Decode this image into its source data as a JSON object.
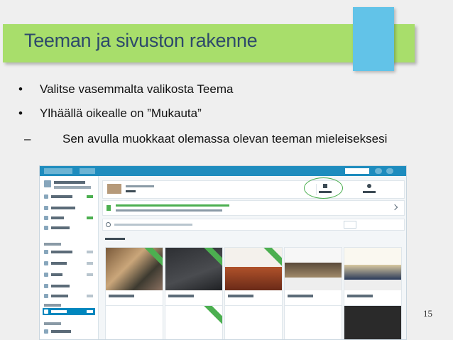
{
  "slide": {
    "title": "Teeman ja sivuston rakenne",
    "bullets": [
      {
        "marker": "•",
        "text": "Valitse vasemmalta valikosta Teema"
      },
      {
        "marker": "•",
        "text": "Ylhäällä oikealle on ”Mukauta”"
      }
    ],
    "sub_bullet": {
      "marker": "–",
      "text": "Sen avulla muokkaat olemassa olevan teeman mieleiseksesi"
    },
    "page_number": "15"
  },
  "colors": {
    "title_bar": "#a8de6b",
    "title_text": "#2e4a6b",
    "corner_tab": "#62c3e8",
    "wp_admin_bar": "#1e8cbe",
    "highlight_oval": "#4caf50"
  },
  "screenshot": {
    "description_icons": [
      "wordpress-logo-icon",
      "customize-icon",
      "info-icon",
      "search-icon"
    ]
  }
}
